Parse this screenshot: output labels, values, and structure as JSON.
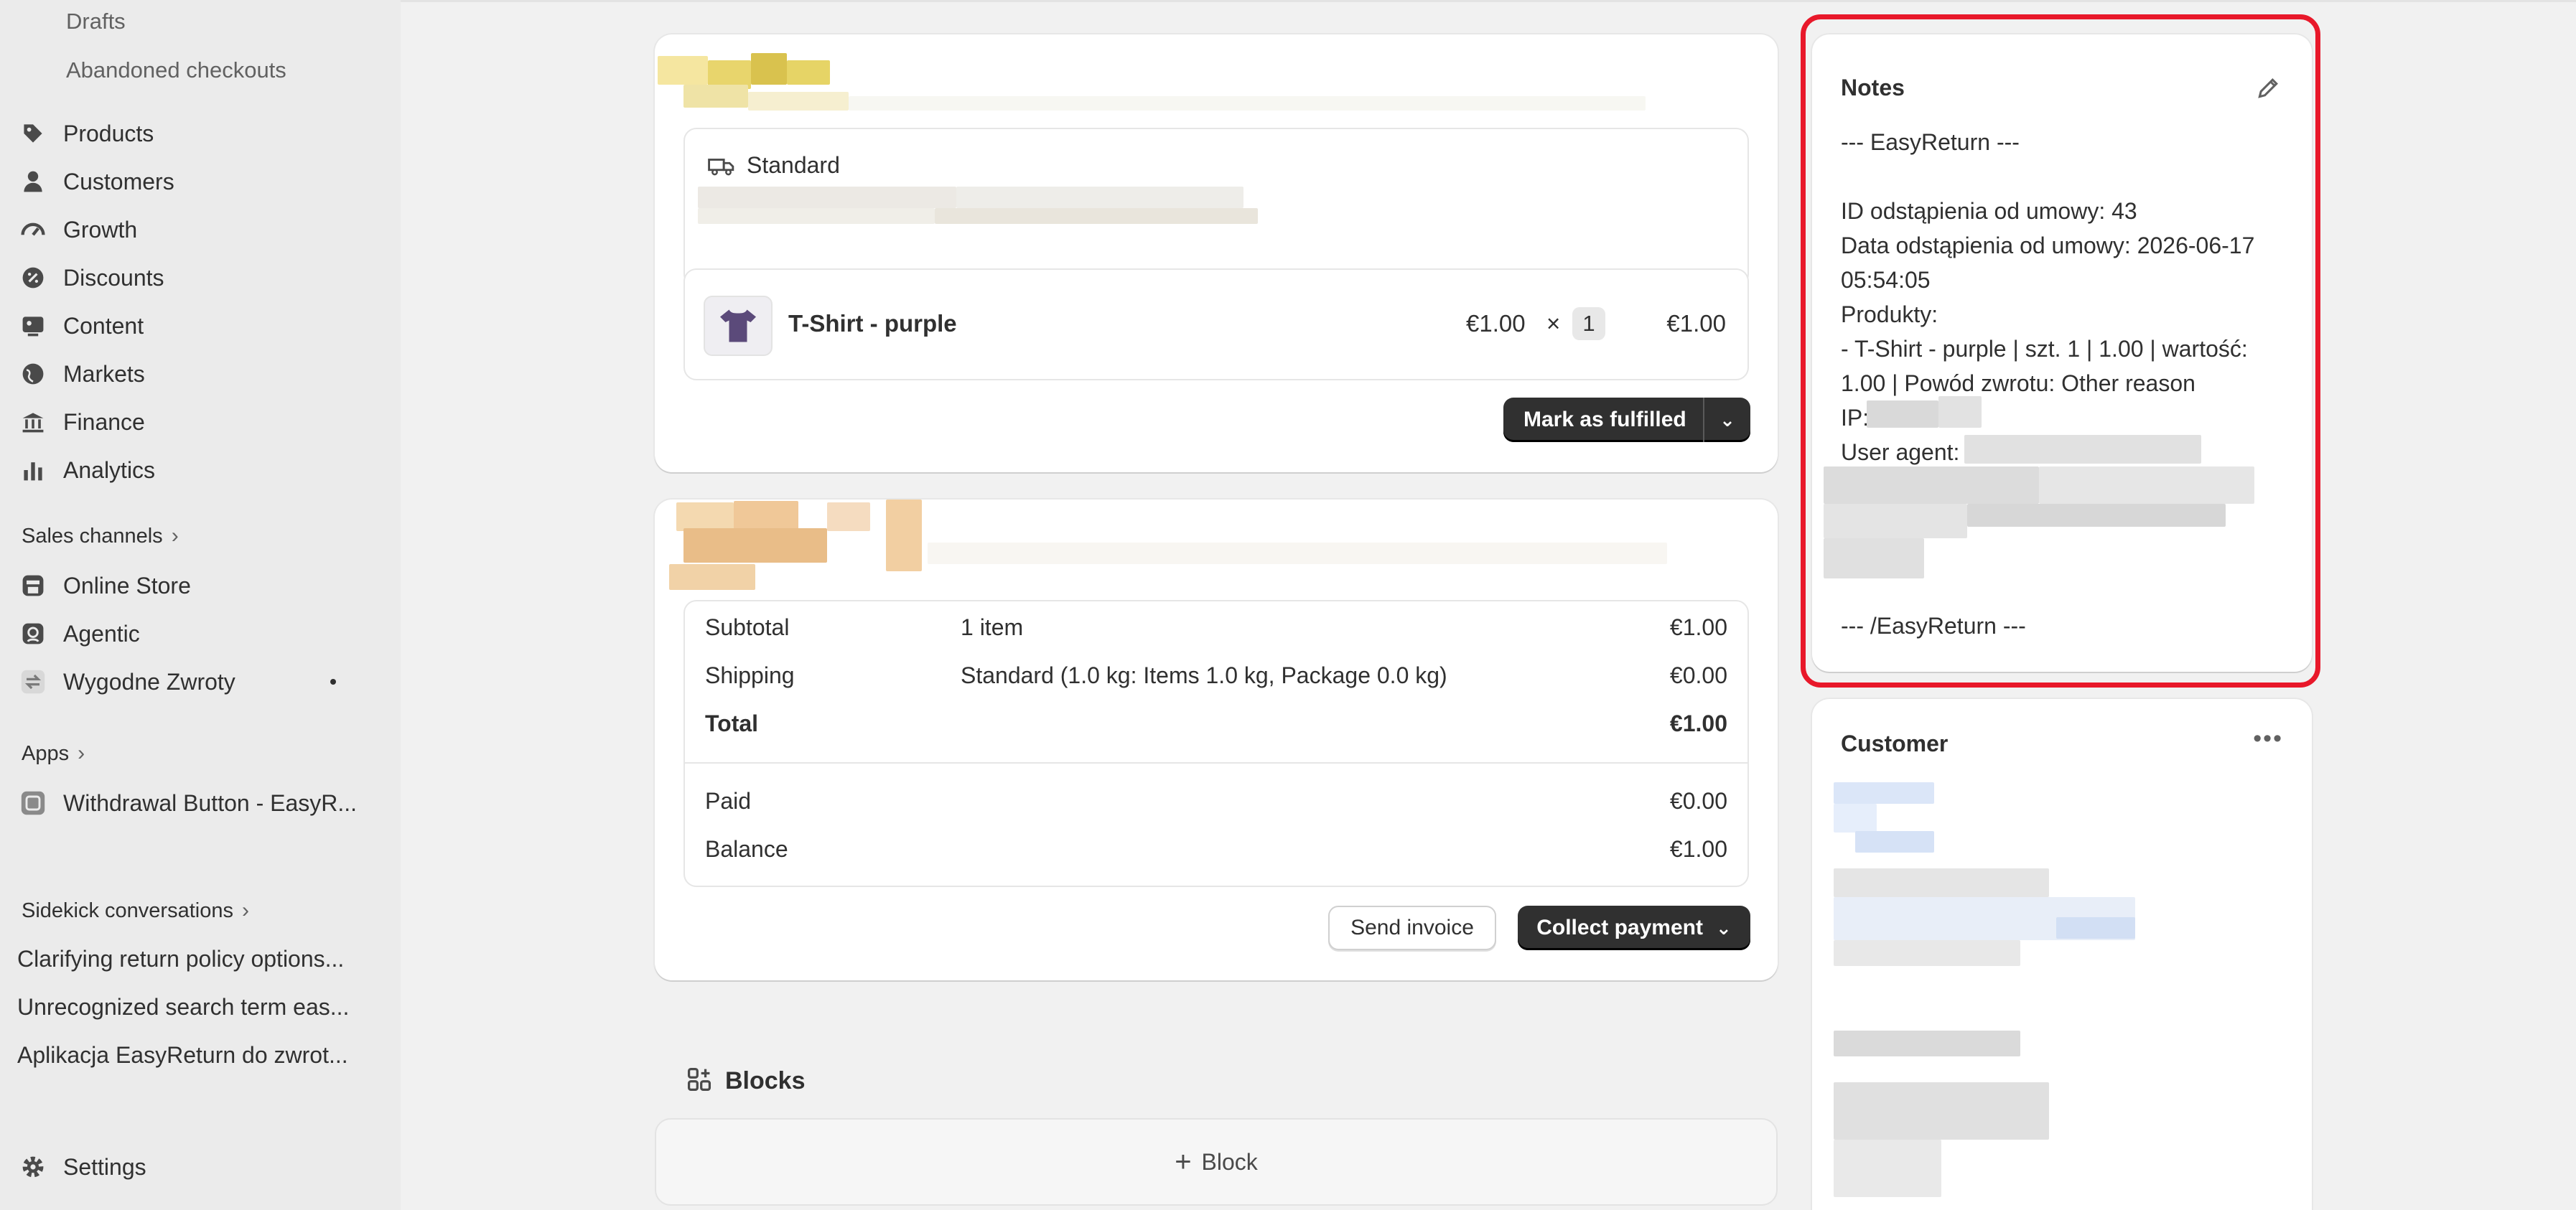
{
  "sidebar": {
    "sub_items": [
      "Drafts",
      "Abandoned checkouts"
    ],
    "items": [
      {
        "label": "Products",
        "icon": "tag-icon"
      },
      {
        "label": "Customers",
        "icon": "person-icon"
      },
      {
        "label": "Growth",
        "icon": "gauge-icon"
      },
      {
        "label": "Discounts",
        "icon": "discount-icon"
      },
      {
        "label": "Content",
        "icon": "content-icon"
      },
      {
        "label": "Markets",
        "icon": "globe-icon"
      },
      {
        "label": "Finance",
        "icon": "bank-icon"
      },
      {
        "label": "Analytics",
        "icon": "bar-chart-icon"
      }
    ],
    "sales_channels_title": "Sales channels",
    "channels": [
      {
        "label": "Online Store",
        "icon": "store-icon"
      },
      {
        "label": "Agentic",
        "icon": "agentic-icon"
      },
      {
        "label": "Wygodne Zwroty",
        "icon": "returns-app-icon"
      }
    ],
    "apps_title": "Apps",
    "apps": [
      {
        "label": "Withdrawal Button - EasyR...",
        "icon": "app-icon"
      }
    ],
    "sidekick_title": "Sidekick conversations",
    "conversations": [
      "Clarifying return policy options...",
      "Unrecognized search term eas...",
      "Aplikacja EasyReturn do zwrot..."
    ],
    "settings_label": "Settings"
  },
  "fulfillment": {
    "shipping_method": "Standard",
    "product_name": "T-Shirt - purple",
    "unit_price": "€1.00",
    "times": "×",
    "quantity": "1",
    "line_total": "€1.00",
    "mark_fulfilled_label": "Mark as fulfilled"
  },
  "payment": {
    "rows": [
      {
        "label": "Subtotal",
        "detail": "1 item",
        "value": "€1.00"
      },
      {
        "label": "Shipping",
        "detail": "Standard (1.0 kg: Items 1.0 kg, Package 0.0 kg)",
        "value": "€0.00"
      },
      {
        "label": "Total",
        "detail": "",
        "value": "€1.00"
      }
    ],
    "paid_label": "Paid",
    "paid_value": "€0.00",
    "balance_label": "Balance",
    "balance_value": "€1.00",
    "send_invoice_label": "Send invoice",
    "collect_payment_label": "Collect payment"
  },
  "blocks": {
    "title": "Blocks",
    "add_block_label": "Block"
  },
  "notes": {
    "title": "Notes",
    "lines": [
      "--- EasyReturn ---",
      "",
      "ID odstąpienia od umowy: 43",
      "Data odstąpienia od umowy: 2026-06-17",
      "05:54:05",
      "Produkty:",
      "- T-Shirt - purple | szt. 1 | 1.00 | wartość:",
      "1.00 | Powód zwrotu: Other reason",
      "IP:",
      "User agent:"
    ],
    "footer_line": "--- /EasyReturn ---"
  },
  "customer": {
    "title": "Customer"
  },
  "colors": {
    "highlight": "#e8182a",
    "dark_button": "#303030",
    "background": "#f1f1f1",
    "sidebar": "#ebebeb"
  }
}
